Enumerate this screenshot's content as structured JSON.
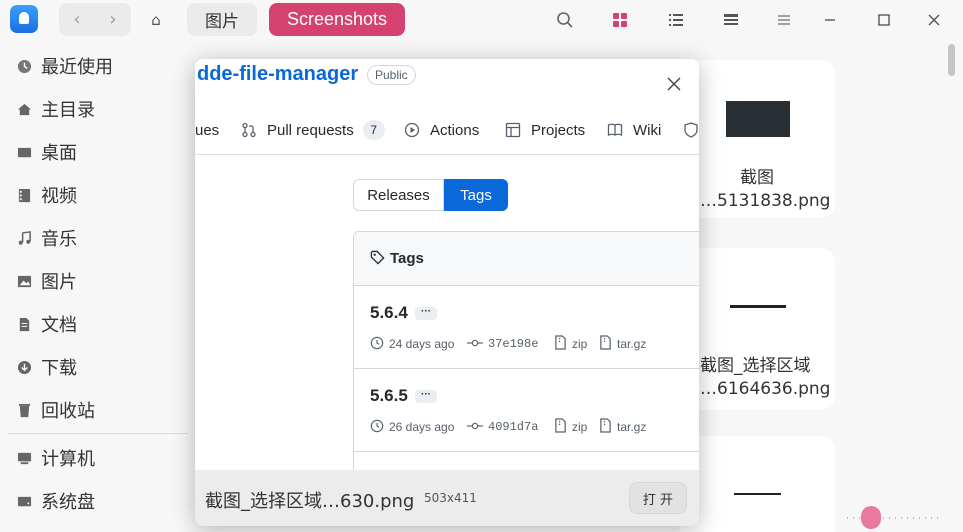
{
  "titlebar": {
    "back_icon": "chevron-left-icon",
    "forward_icon": "chevron-right-icon",
    "home_icon": "home-icon",
    "crumbs": [
      "图片",
      "Screenshots"
    ],
    "accent_color": "#d64270"
  },
  "sidebar": {
    "items": [
      {
        "label": "最近使用",
        "icon": "clock-icon"
      },
      {
        "label": "主目录",
        "icon": "home-icon"
      },
      {
        "label": "桌面",
        "icon": "desktop-icon"
      },
      {
        "label": "视频",
        "icon": "video-icon"
      },
      {
        "label": "音乐",
        "icon": "music-icon"
      },
      {
        "label": "图片",
        "icon": "picture-icon"
      },
      {
        "label": "文档",
        "icon": "document-icon"
      },
      {
        "label": "下载",
        "icon": "download-icon"
      },
      {
        "label": "回收站",
        "icon": "trash-icon"
      },
      {
        "label": "计算机",
        "icon": "computer-icon"
      },
      {
        "label": "系统盘",
        "icon": "disk-icon"
      }
    ]
  },
  "files": [
    {
      "name_line1": "截图",
      "name_line2": "…5131838.png"
    },
    {
      "name_line1": "截图_选择区域",
      "name_line2": "…6164636.png"
    }
  ],
  "preview": {
    "repo_name": "dde-file-manager",
    "visibility": "Public",
    "tabs": [
      {
        "label": "ues",
        "icon": "issues-icon"
      },
      {
        "label": "Pull requests",
        "icon": "pull-request-icon",
        "count": "7"
      },
      {
        "label": "Actions",
        "icon": "play-icon"
      },
      {
        "label": "Projects",
        "icon": "table-icon"
      },
      {
        "label": "Wiki",
        "icon": "book-icon"
      }
    ],
    "segment": {
      "releases": "Releases",
      "tags": "Tags"
    },
    "tags_heading": "Tags",
    "tags": [
      {
        "name": "5.6.4",
        "more": "···",
        "age": "24 days ago",
        "commit": "37e198e",
        "zip": "zip",
        "tar": "tar.gz"
      },
      {
        "name": "5.6.5",
        "more": "···",
        "age": "26 days ago",
        "commit": "4091d7a",
        "zip": "zip",
        "tar": "tar.gz"
      }
    ],
    "footer": {
      "filename": "截图_选择区域…630.png",
      "dimensions": "503x411",
      "open_label": "打 开"
    }
  }
}
